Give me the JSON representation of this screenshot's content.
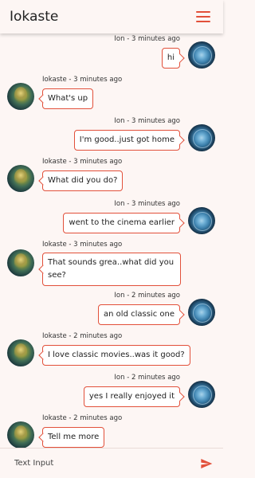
{
  "header": {
    "title": "Iokaste"
  },
  "messages": [
    {
      "side": "right",
      "sender": "Ion",
      "time": "3 minutes ago",
      "text": "hi"
    },
    {
      "side": "left",
      "sender": "Iokaste",
      "time": "3 minutes ago",
      "text": "What's up"
    },
    {
      "side": "right",
      "sender": "Ion",
      "time": "3 minutes ago",
      "text": "I'm good..just got home"
    },
    {
      "side": "left",
      "sender": "Iokaste",
      "time": "3 minutes ago",
      "text": "What did you do?"
    },
    {
      "side": "right",
      "sender": "Ion",
      "time": "3 minutes ago",
      "text": "went to the cinema earlier"
    },
    {
      "side": "left",
      "sender": "Iokaste",
      "time": "3 minutes ago",
      "text": "That sounds grea..what did you see?"
    },
    {
      "side": "right",
      "sender": "Ion",
      "time": "2 minutes ago",
      "text": "an old classic one"
    },
    {
      "side": "left",
      "sender": "Iokaste",
      "time": "2 minutes ago",
      "text": "I love classic movies..was it good?"
    },
    {
      "side": "right",
      "sender": "Ion",
      "time": "2 minutes ago",
      "text": "yes I really enjoyed it"
    },
    {
      "side": "left",
      "sender": "Iokaste",
      "time": "2 minutes ago",
      "text": "Tell me more"
    }
  ],
  "meta": [
    "Ion - 3 minutes ago",
    "Iokaste - 3 minutes ago",
    "Ion - 3 minutes ago",
    "Iokaste - 3 minutes ago",
    "Ion - 3 minutes ago",
    "Iokaste - 3 minutes ago",
    "Ion - 2 minutes ago",
    "Iokaste - 2 minutes ago",
    "Ion - 2 minutes ago",
    "Iokaste - 2 minutes ago"
  ],
  "input": {
    "placeholder": "Text Input"
  },
  "icons": {
    "menu": "menu-icon",
    "send": "send-icon"
  },
  "colors": {
    "accent": "#e2503a",
    "background": "#fdf6f4"
  }
}
